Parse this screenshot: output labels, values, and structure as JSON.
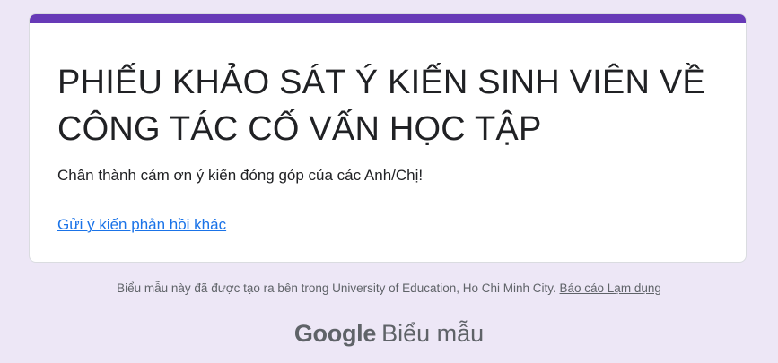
{
  "form": {
    "title": "PHIẾU KHẢO SÁT Ý KIẾN SINH VIÊN VỀ CÔNG TÁC CỐ VẤN HỌC TẬP",
    "description": "Chân thành cám ơn ý kiến đóng góp của các Anh/Chị!",
    "feedback_link": "Gửi ý kiến phản hồi khác"
  },
  "footer": {
    "note": "Biểu mẫu này đã được tạo ra bên trong University of Education, Ho Chi Minh City.",
    "abuse_link": "Báo cáo Lạm dụng"
  },
  "brand": {
    "logo": "Google",
    "product": "Biểu mẫu"
  },
  "colors": {
    "accent": "#673ab7",
    "background": "#ede7f6",
    "link": "#1a73e8"
  }
}
